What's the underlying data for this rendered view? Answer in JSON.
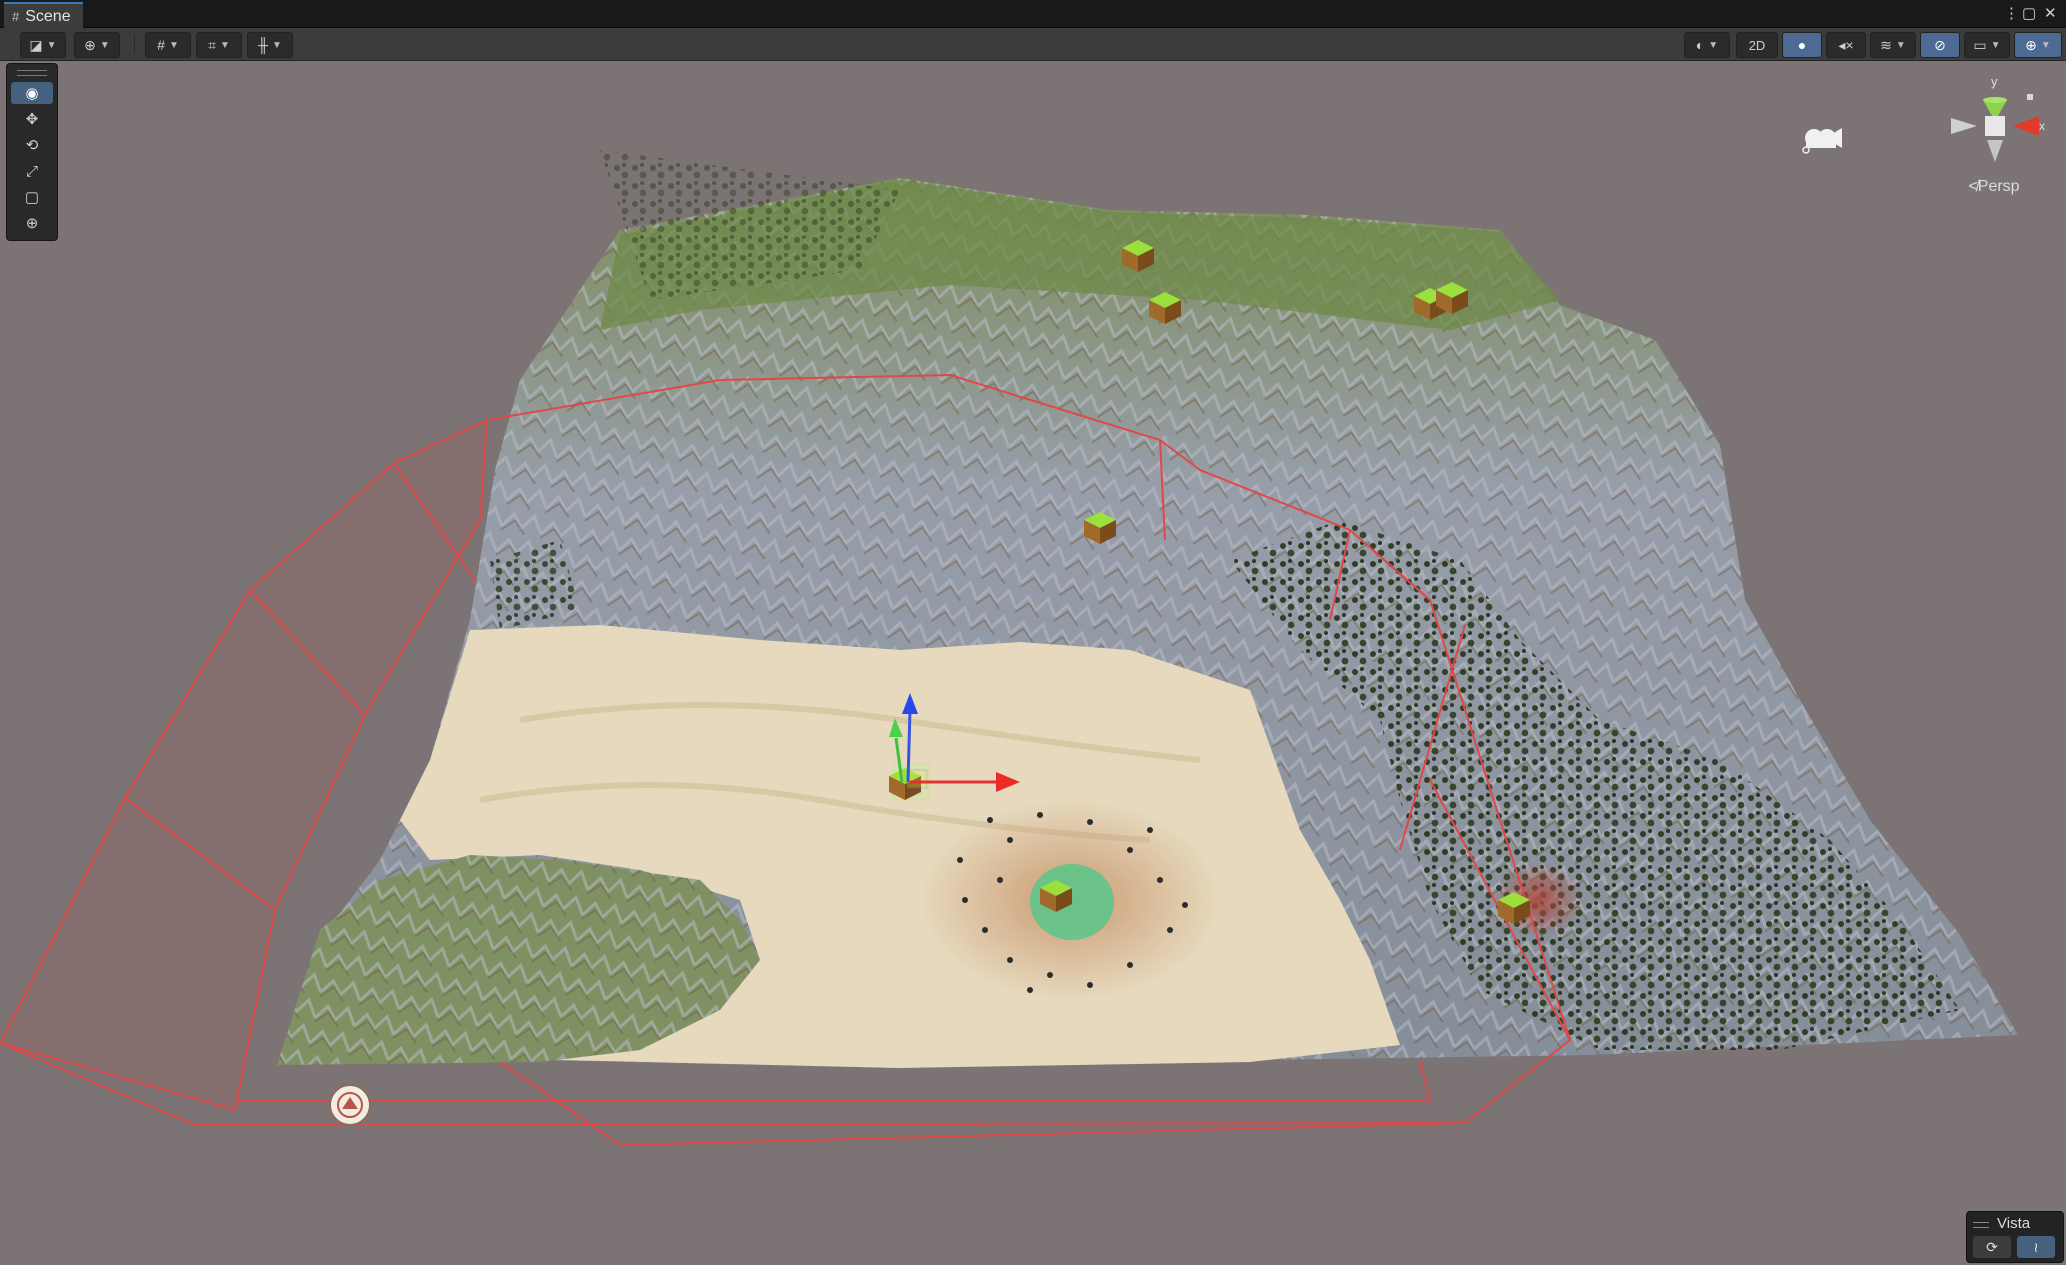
{
  "window": {
    "tab_label": "Scene",
    "tab_icon": "hash-icon",
    "controls": [
      "⋮",
      "▢",
      "✕"
    ]
  },
  "toolbar": {
    "left": [
      {
        "name": "draw-mode-button",
        "icon": "draw-mode-icon",
        "glyph": "◪",
        "dropdown": true
      },
      {
        "name": "global-toggle-button",
        "icon": "globe-icon",
        "glyph": "⊕",
        "dropdown": true
      },
      {
        "name": "grid-snapping-button",
        "icon": "grid-icon",
        "glyph": "#",
        "dropdown": true
      },
      {
        "name": "increment-snap-button",
        "icon": "snap-increment-icon",
        "glyph": "⌗",
        "dropdown": true
      },
      {
        "name": "align-button",
        "icon": "align-icon",
        "glyph": "╫",
        "dropdown": true
      }
    ],
    "right": [
      {
        "name": "shading-mode-button",
        "icon": "shading-sphere-icon",
        "glyph": "◐",
        "dropdown": true,
        "active": false
      },
      {
        "name": "2d-toggle-button",
        "label": "2D",
        "active": false
      },
      {
        "name": "lighting-toggle-button",
        "icon": "lightbulb-icon",
        "glyph": "💡",
        "active": true
      },
      {
        "name": "audio-toggle-button",
        "icon": "speaker-muted-icon",
        "glyph": "🔇",
        "active": false
      },
      {
        "name": "effects-button",
        "icon": "layers-icon",
        "glyph": "≋",
        "dropdown": true,
        "active": false
      },
      {
        "name": "scene-visibility-button",
        "icon": "eye-hidden-icon",
        "glyph": "⊘",
        "active": true
      },
      {
        "name": "camera-settings-button",
        "icon": "camera-icon",
        "glyph": "▭",
        "dropdown": true,
        "active": false
      },
      {
        "name": "gizmos-button",
        "icon": "gizmo-globe-icon",
        "glyph": "⊕",
        "dropdown": true,
        "active": true
      }
    ]
  },
  "tools": [
    {
      "name": "view-tool",
      "icon": "eye-icon",
      "glyph": "👁",
      "active": true
    },
    {
      "name": "move-tool",
      "icon": "move-arrows-icon",
      "glyph": "✥",
      "active": false
    },
    {
      "name": "rotate-tool",
      "icon": "rotate-icon",
      "glyph": "⟲",
      "active": false
    },
    {
      "name": "scale-tool",
      "icon": "scale-icon",
      "glyph": "⤢",
      "active": false
    },
    {
      "name": "rect-tool",
      "icon": "rect-transform-icon",
      "glyph": "▢",
      "active": false
    },
    {
      "name": "transform-tool",
      "icon": "transform-icon",
      "glyph": "⊕",
      "active": false
    }
  ],
  "gizmo": {
    "y_label": "y",
    "x_label": "x",
    "projection_label": "≮Persp"
  },
  "vista_overlay": {
    "title": "Vista",
    "buttons": [
      {
        "name": "vista-refresh-button",
        "icon": "refresh-icon",
        "glyph": "⟳",
        "active": false
      },
      {
        "name": "vista-graph-button",
        "icon": "graph-icon",
        "glyph": "≀",
        "active": true
      }
    ]
  },
  "colors": {
    "background": "#7c7474",
    "toolbar": "#3c3c3c",
    "titlebar": "#191919",
    "accent": "#4c6a92",
    "tab_accent": "#3a79bb",
    "boundary_lines": "#e04848",
    "sand": "#e6d9bd",
    "rock": "#8e96a4",
    "grass": "#6f8a4a",
    "forest": "#2e3f22"
  }
}
